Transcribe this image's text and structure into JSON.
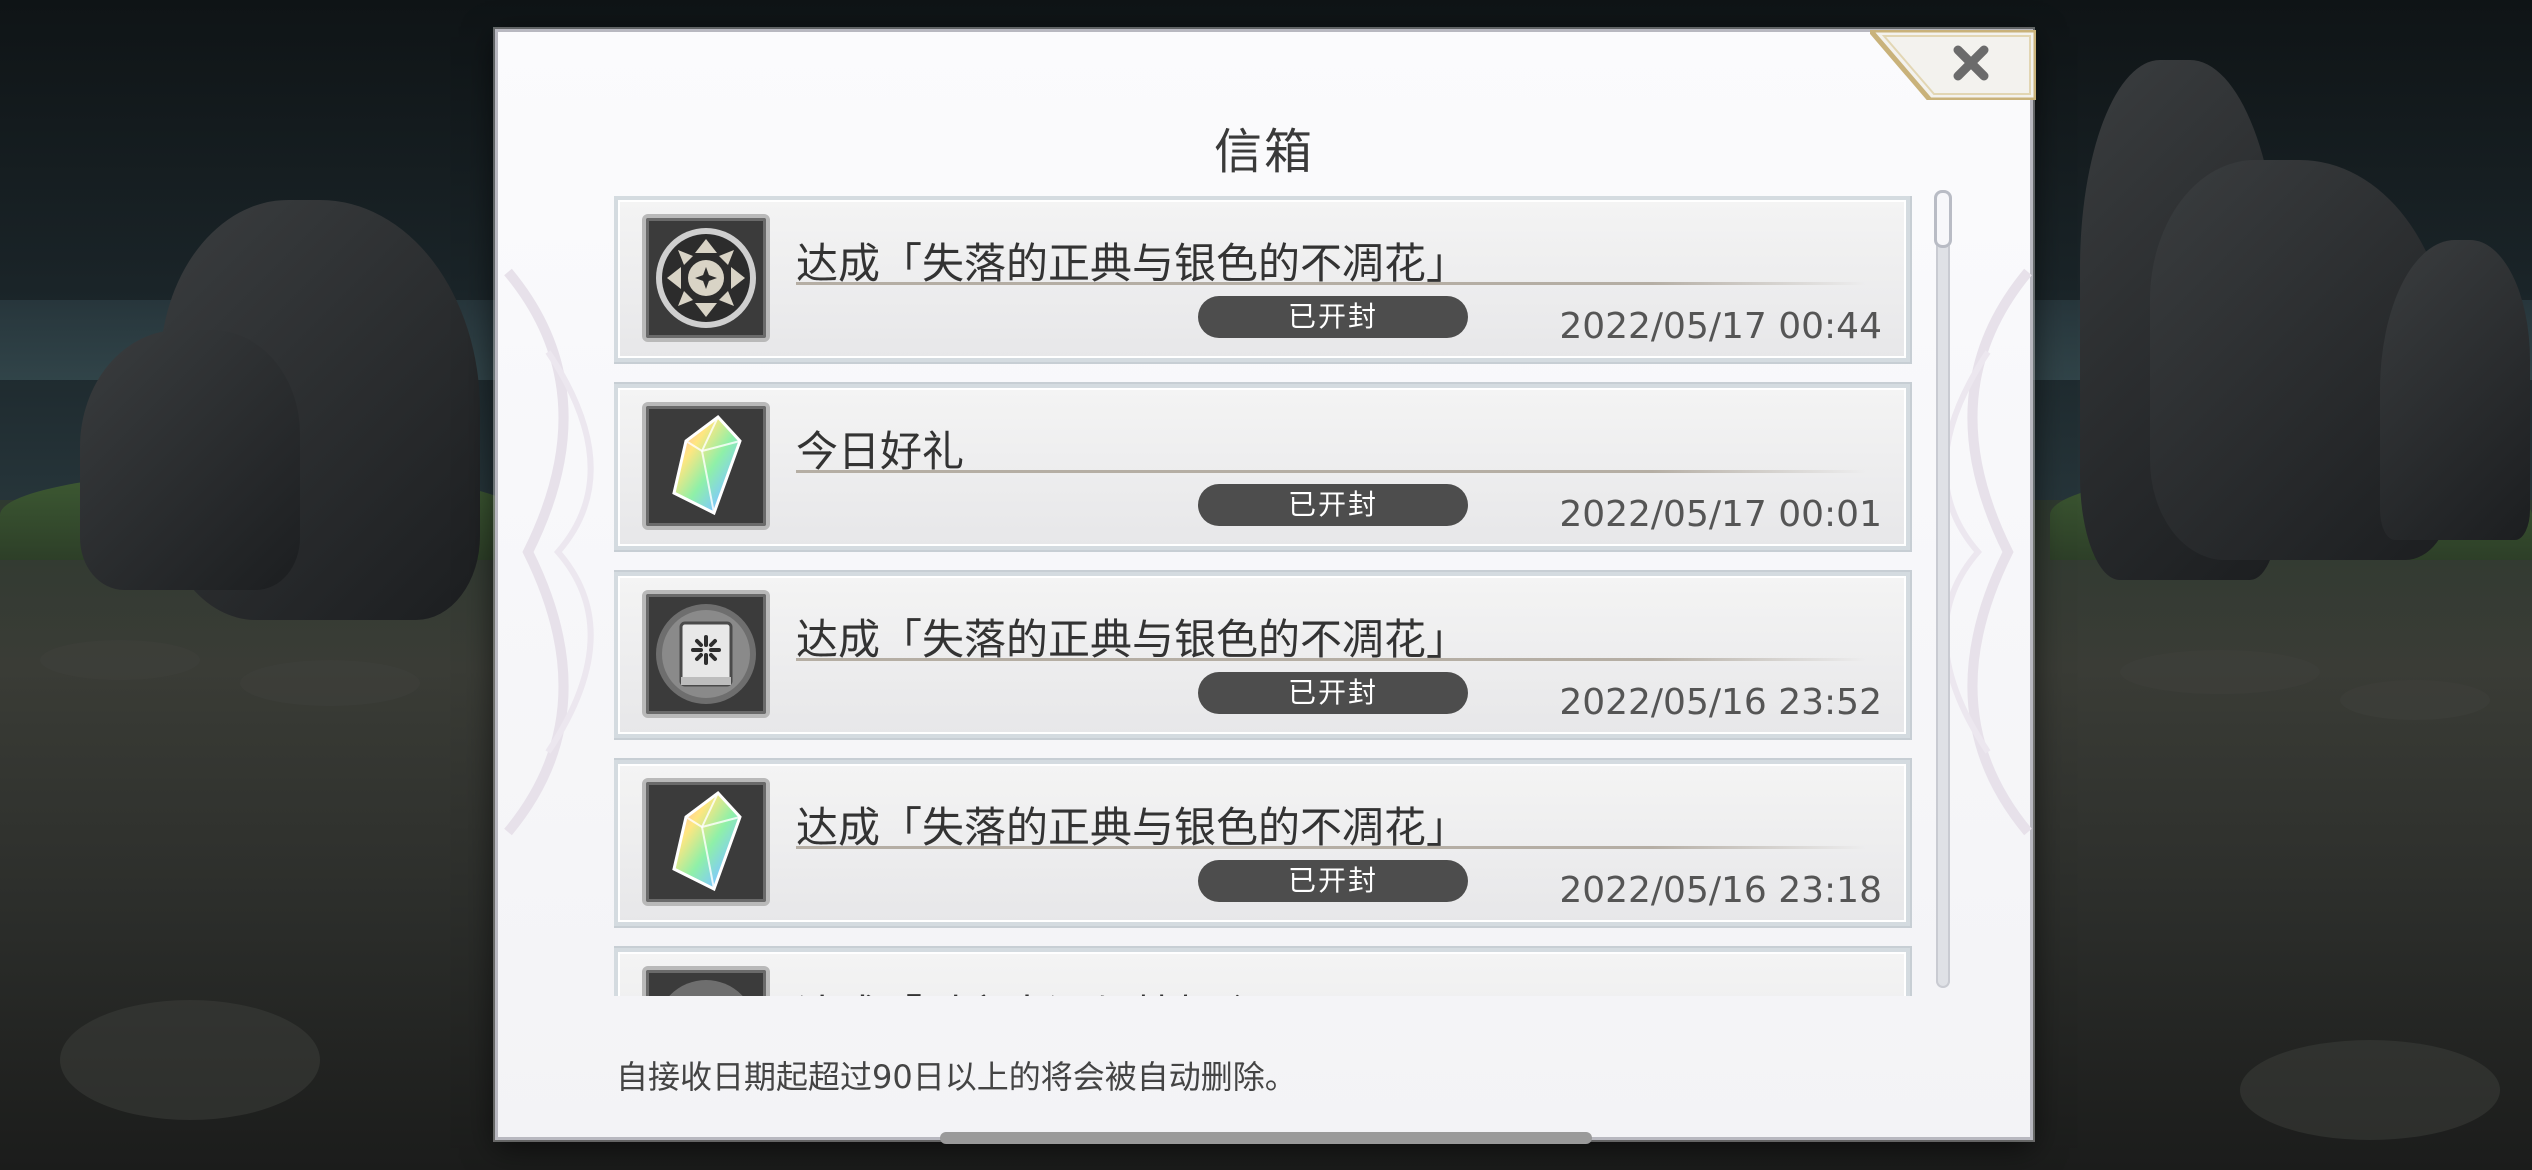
{
  "dialog": {
    "title": "信箱",
    "close_icon": "close-x-icon",
    "footer_note": "自接收日期起超过90日以上的将会被自动删除。"
  },
  "mails": [
    {
      "subject": "达成「失落的正典与银色的不凋花」",
      "status": "已开封",
      "date": "2022/05/17 00:44",
      "icon": "medal-emblem-icon"
    },
    {
      "subject": "今日好礼",
      "status": "已开封",
      "date": "2022/05/17 00:01",
      "icon": "rainbow-crystal-icon"
    },
    {
      "subject": "达成「失落的正典与银色的不凋花」",
      "status": "已开封",
      "date": "2022/05/16 23:52",
      "icon": "book-emblem-icon"
    },
    {
      "subject": "达成「失落的正典与银色的不凋花」",
      "status": "已开封",
      "date": "2022/05/16 23:18",
      "icon": "rainbow-crystal-icon"
    },
    {
      "subject": "达成「时之岸辺与梦想乡」",
      "status": "",
      "date": "",
      "icon": "book-emblem-icon"
    }
  ],
  "colors": {
    "badge_bg": "#4d4d4d",
    "panel_bg": "#f4f4f6",
    "gold_trim": "#c9b27a"
  }
}
